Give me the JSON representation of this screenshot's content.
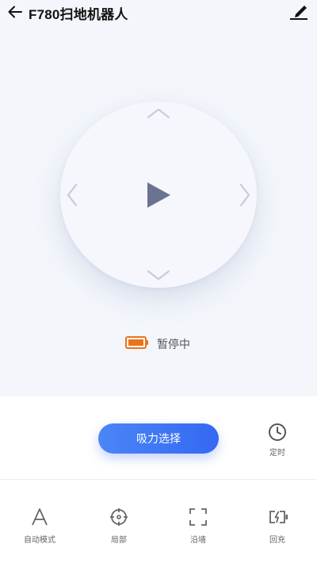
{
  "header": {
    "title": "F780扫地机器人"
  },
  "status": {
    "text": "暂停中",
    "battery_color": "#e8741a"
  },
  "controls": {
    "suction_label": "吸力选择",
    "timer_label": "定时"
  },
  "bottom_nav": {
    "items": [
      {
        "label": "自动模式",
        "icon": "auto-mode-icon"
      },
      {
        "label": "局部",
        "icon": "crosshair-icon"
      },
      {
        "label": "沿墙",
        "icon": "frame-corners-icon"
      },
      {
        "label": "回充",
        "icon": "battery-charge-icon"
      }
    ]
  },
  "colors": {
    "accent": "#3a6ff4",
    "background_top": "#f3f6fb",
    "play": "#6b7393",
    "arrows": "#c6cbe0"
  }
}
